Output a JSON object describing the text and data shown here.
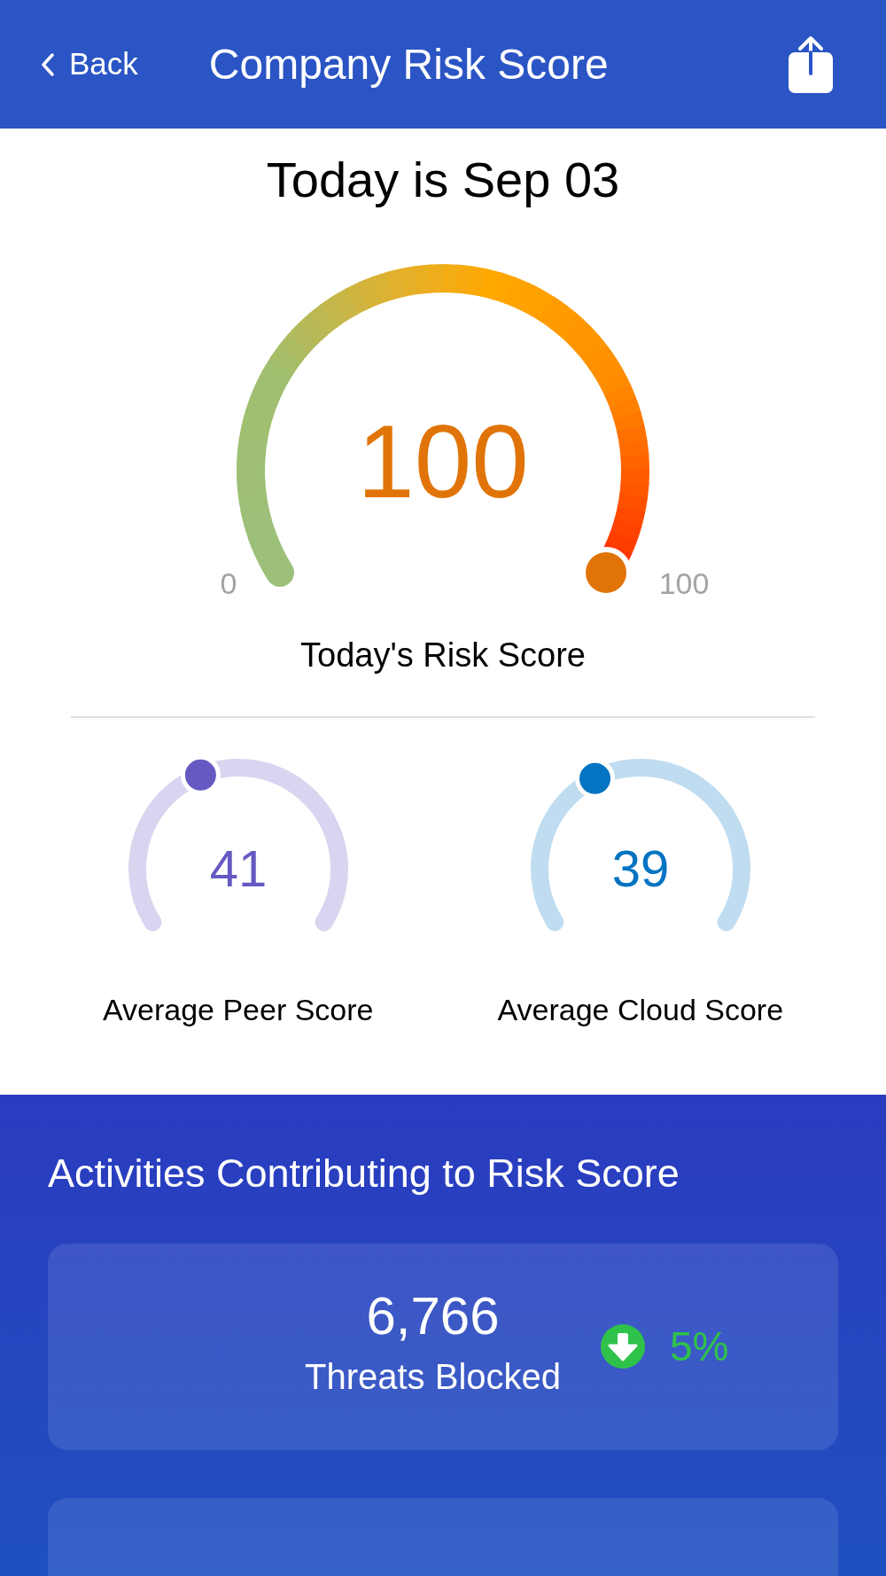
{
  "header": {
    "back": "Back",
    "title": "Company Risk Score"
  },
  "date": "Today is Sep 03",
  "main_gauge": {
    "value": "100",
    "min_label": "0",
    "max_label": "100",
    "label": "Today's Risk Score"
  },
  "peer_gauges": [
    {
      "value": "41",
      "color": "#6559c2",
      "label": "Average Peer Score"
    },
    {
      "value": "39",
      "color": "#0274c2",
      "label": "Average Cloud Score"
    }
  ],
  "activities": {
    "title": "Activities Contributing to Risk Score",
    "cards": [
      {
        "kind": "full",
        "value": "6,766",
        "label": "Threats Blocked",
        "trend": {
          "kind": "down",
          "change": "5%"
        }
      },
      {
        "kind": "cut_off"
      }
    ]
  }
}
